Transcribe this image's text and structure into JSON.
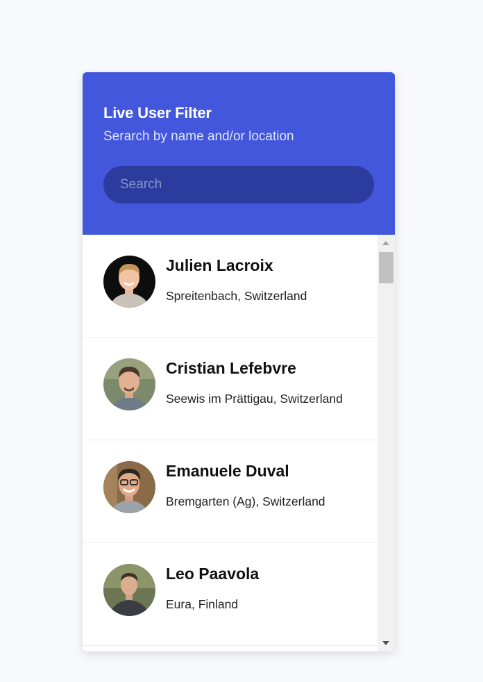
{
  "header": {
    "title": "Live User Filter",
    "subtitle": "Serarch by name and/or location",
    "search_placeholder": "Search",
    "search_value": ""
  },
  "colors": {
    "header_bg": "#4257dc",
    "search_bg": "#2c3c9e",
    "page_bg": "#f8f9fd"
  },
  "users": [
    {
      "name": "Julien Lacroix",
      "location": "Spreitenbach, Switzerland",
      "avatar_icon": "avatar-photo"
    },
    {
      "name": "Cristian Lefebvre",
      "location": "Seewis im Prättigau, Switzerland",
      "avatar_icon": "avatar-photo"
    },
    {
      "name": "Emanuele Duval",
      "location": "Bremgarten (Ag), Switzerland",
      "avatar_icon": "avatar-photo"
    },
    {
      "name": "Leo Paavola",
      "location": "Eura, Finland",
      "avatar_icon": "avatar-photo"
    }
  ]
}
